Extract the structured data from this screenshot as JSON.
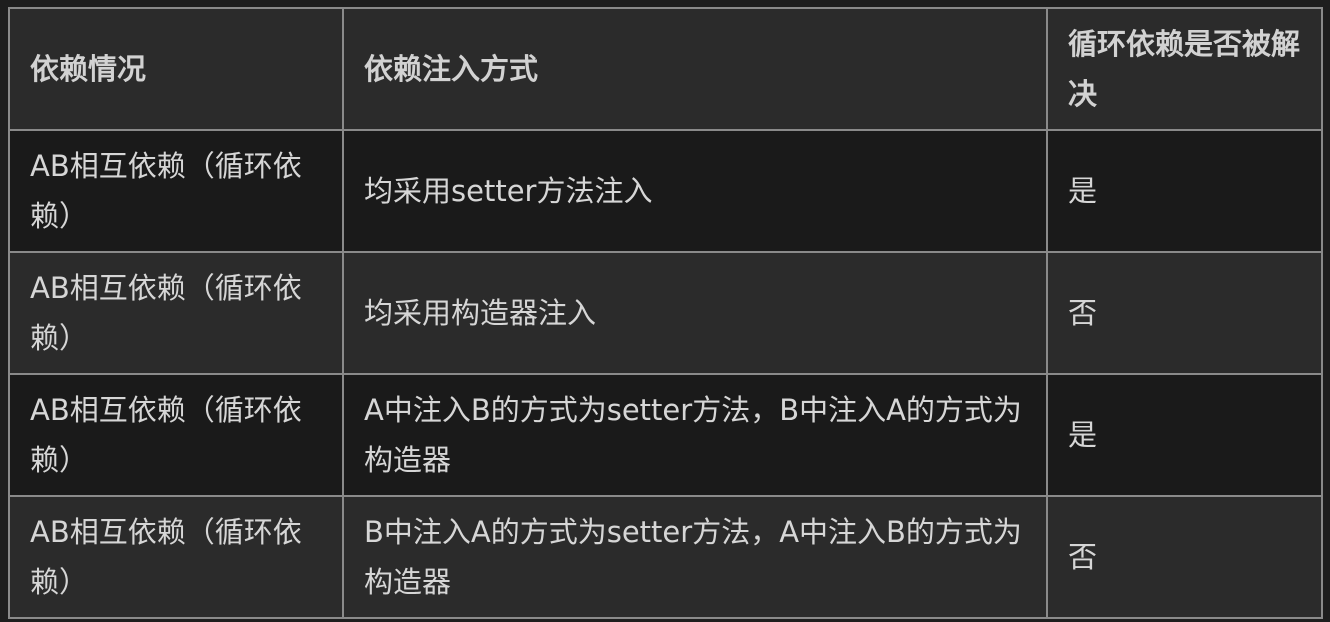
{
  "table": {
    "headers": [
      "依赖情况",
      "依赖注入方式",
      "循环依赖是否被解决"
    ],
    "rows": [
      [
        "AB相互依赖（循环依赖）",
        "均采用setter方法注入",
        "是"
      ],
      [
        "AB相互依赖（循环依赖）",
        "均采用构造器注入",
        "否"
      ],
      [
        "AB相互依赖（循环依赖）",
        "A中注入B的方式为setter方法，B中注入A的方式为构造器",
        "是"
      ],
      [
        "AB相互依赖（循环依赖）",
        "B中注入A的方式为setter方法，A中注入B的方式为构造器",
        "否"
      ]
    ]
  },
  "colors": {
    "background": "#1e1e1e",
    "header_bg": "#2b2b2b",
    "row_dark": "#1a1a1a",
    "row_light": "#2b2b2b",
    "border": "#8a8a8a",
    "text": "#d6d6d6"
  }
}
